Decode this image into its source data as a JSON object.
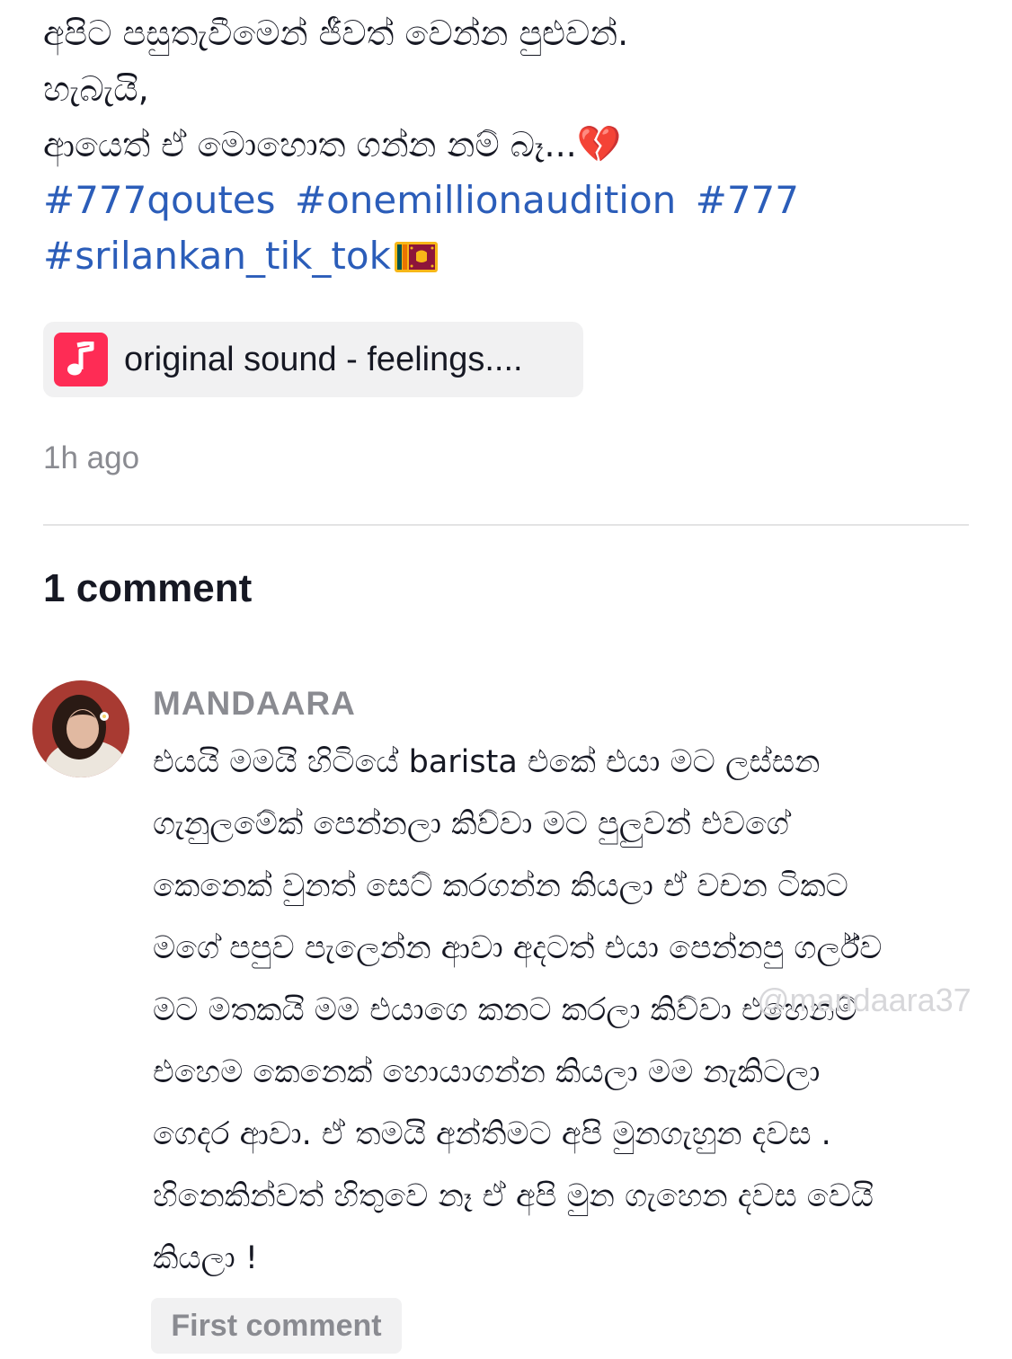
{
  "post": {
    "caption_lines": [
      "අපිට පසුතැවීමෙන් ජීවත් වෙන්න පුළුවන්.",
      "හැබැයි,",
      "ආයෙත් ඒ මොහොත ගන්න නම් බෑ..."
    ],
    "caption_emoji": "💔",
    "hashtags_line1": [
      "#777qoutes",
      "#onemillionaudition",
      "#777"
    ],
    "hashtags_line2": [
      "#srilankan_tik_tok"
    ],
    "flag_icon": "sri-lanka-flag-icon",
    "sound_icon": "music-note-icon",
    "sound_label": "original sound - feelings....",
    "timestamp": "1h ago"
  },
  "comments_section": {
    "count_label": "1 comment",
    "comments": [
      {
        "author": "MANDAARA",
        "avatar_icon": "user-avatar-icon",
        "lines": [
          "එයයි මමයි හිටියේ barista එකේ එයා මට ලස්සන",
          "ගැනුලමේක් පෙන්නලා කිව්වා මට පුලුවන් එවගේ",
          "කෙනෙක් වුනත් සෙට් කරගන්න කියලා ඒ වචන ටිකට",
          "මගේ පපුව පැලෙන්න ආවා අදටත් එයා පෙන්නපු ගර්ල්ව",
          "මට මතකයි මම එයාගෙ කනට කරලා කිව්වා එහෙනම්",
          "එහෙම කෙනෙක් හොයාගන්න කියලා මම නැකිටලා",
          "ගෙදර ආවා. ඒ තමයි අන්තිමට අපි මුනගැහුන දවස .",
          "හිනෙකින්වත් හිතුවෙ නෑ ඒ අපි මුන ගැහෙන දවස වෙයි",
          "කියලා !"
        ],
        "badge": "First comment"
      }
    ]
  },
  "watermark": "@mandaara37",
  "colors": {
    "hashtag": "#2b5db9",
    "sound_icon_bg": "#fe2c55",
    "muted_text": "#8a8b91",
    "pill_bg": "#f1f1f2",
    "divider": "#e3e3e4"
  }
}
